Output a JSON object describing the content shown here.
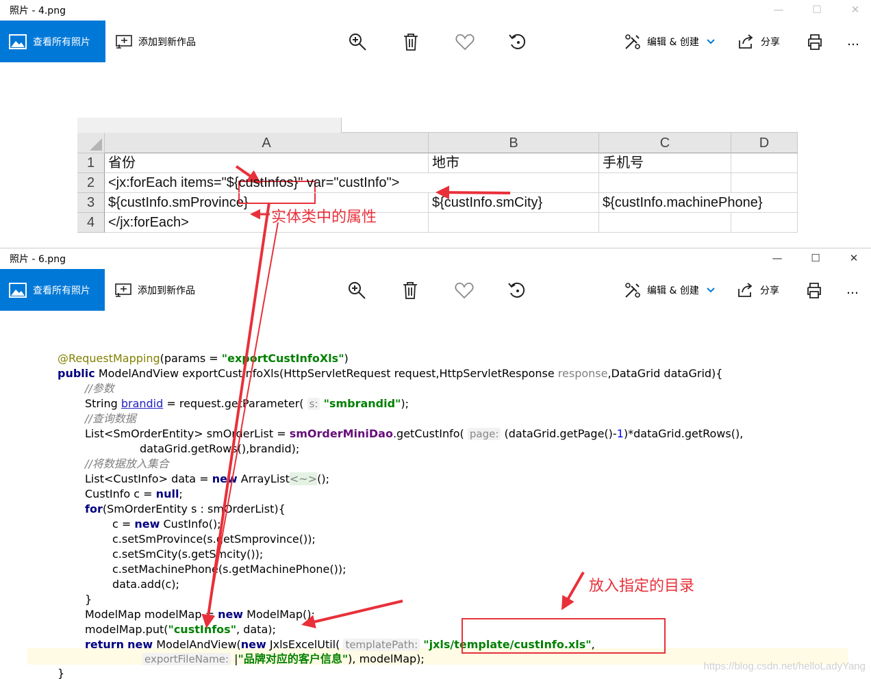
{
  "window_top": {
    "title": "照片 - 4.png",
    "controls": {
      "minimize": "—",
      "maximize": "☐",
      "close": "✕"
    }
  },
  "window_bottom": {
    "title": "照片 - 6.png",
    "controls": {
      "minimize": "—",
      "maximize": "☐",
      "close": "✕"
    }
  },
  "toolbar": {
    "view_all": "查看所有照片",
    "add_to_creation": "添加到新作品",
    "zoom_icon": "zoom-in-icon",
    "delete_icon": "trash-icon",
    "favorite_icon": "heart-icon",
    "rotate_icon": "rotate-icon",
    "edit_create": "编辑 & 创建",
    "share": "分享",
    "print_icon": "printer-icon",
    "more": "…"
  },
  "spreadsheet": {
    "columns": [
      "A",
      "B",
      "C",
      "D"
    ],
    "rows": [
      "1",
      "2",
      "3",
      "4"
    ],
    "cells": {
      "a1": "省份",
      "b1": "地市",
      "c1": "手机号",
      "a2": "<jx:forEach items=\"${custInfos}\" var=\"custInfo\">",
      "a3": "${custInfo.smProvince}",
      "b3": "${custInfo.smCity}",
      "c3": "${custInfo.machinePhone}",
      "a4": "</jx:forEach>"
    }
  },
  "annotations": {
    "entity_attr": "实体类中的属性",
    "target_dir": "放入指定的目录"
  },
  "code": {
    "l1_ann": "@RequestMapping",
    "l1_rest": "(params = ",
    "l1_str": "\"exportCustInfoXls\"",
    "l1_end": ")",
    "l2_kw": "public",
    "l2_rest": " ModelAndView exportCustInfoXls(HttpServletRequest request,HttpServletResponse ",
    "l2_resp": "response",
    "l2_end": ",DataGrid dataGrid){",
    "l3": "//参数",
    "l4_a": "String ",
    "l4_var": "brandid",
    "l4_b": " = request.getParameter( ",
    "l4_hint": "s:",
    "l4_str": "\"smbrandid\"",
    "l4_end": ");",
    "l5": "//查询数据",
    "l6_a": "List<SmOrderEntity> smOrderList = ",
    "l6_fld": "smOrderMiniDao",
    "l6_b": ".getCustInfo( ",
    "l6_hint": "page:",
    "l6_c": " (dataGrid.getPage()-",
    "l6_num": "1",
    "l6_d": ")*dataGrid.getRows(),",
    "l7": "dataGrid.getRows(),brandid);",
    "l8": "//将数据放入集合",
    "l9_a": "List<CustInfo> data = ",
    "l9_kw": "new",
    "l9_b": " ArrayList",
    "l9_diamond": "<~>",
    "l9_c": "();",
    "l10_a": "CustInfo c = ",
    "l10_null": "null",
    "l10_b": ";",
    "l11_kw": "for",
    "l11_rest": "(SmOrderEntity s : smOrderList){",
    "l12_a": "c = ",
    "l12_kw": "new",
    "l12_b": " CustInfo();",
    "l13": "c.setSmProvince(s.getSmprovince());",
    "l14": "c.setSmCity(s.getSmcity());",
    "l15": "c.setMachinePhone(s.getMachinePhone());",
    "l16": "data.add(c);",
    "l17": "}",
    "l18_a": "ModelMap modelMap = ",
    "l18_kw": "new",
    "l18_b": " ModelMap();",
    "l19_a": "modelMap.put(",
    "l19_str": "\"custInfos\"",
    "l19_b": ", data);",
    "l20_kw": "return",
    "l20_sp": " ",
    "l20_kw2": "new",
    "l20_a": " ModelAndView(",
    "l20_kw3": "new",
    "l20_b": " JxlsExcelUtil( ",
    "l20_hint": "templatePath:",
    "l20_str": "\"jxls/template/custInfo.xls\"",
    "l20_end": ",",
    "l21_hint": "exportFileName:",
    "l21_str": "\"品牌对应的客户信息\"",
    "l21_end": "), modelMap);",
    "l22": "}"
  },
  "watermark": "https://blog.csdn.net/helloLadyYang",
  "colors": {
    "accent": "#0078d7",
    "annotation_red": "#e8303a",
    "keyword": "#000080",
    "string": "#008000"
  }
}
